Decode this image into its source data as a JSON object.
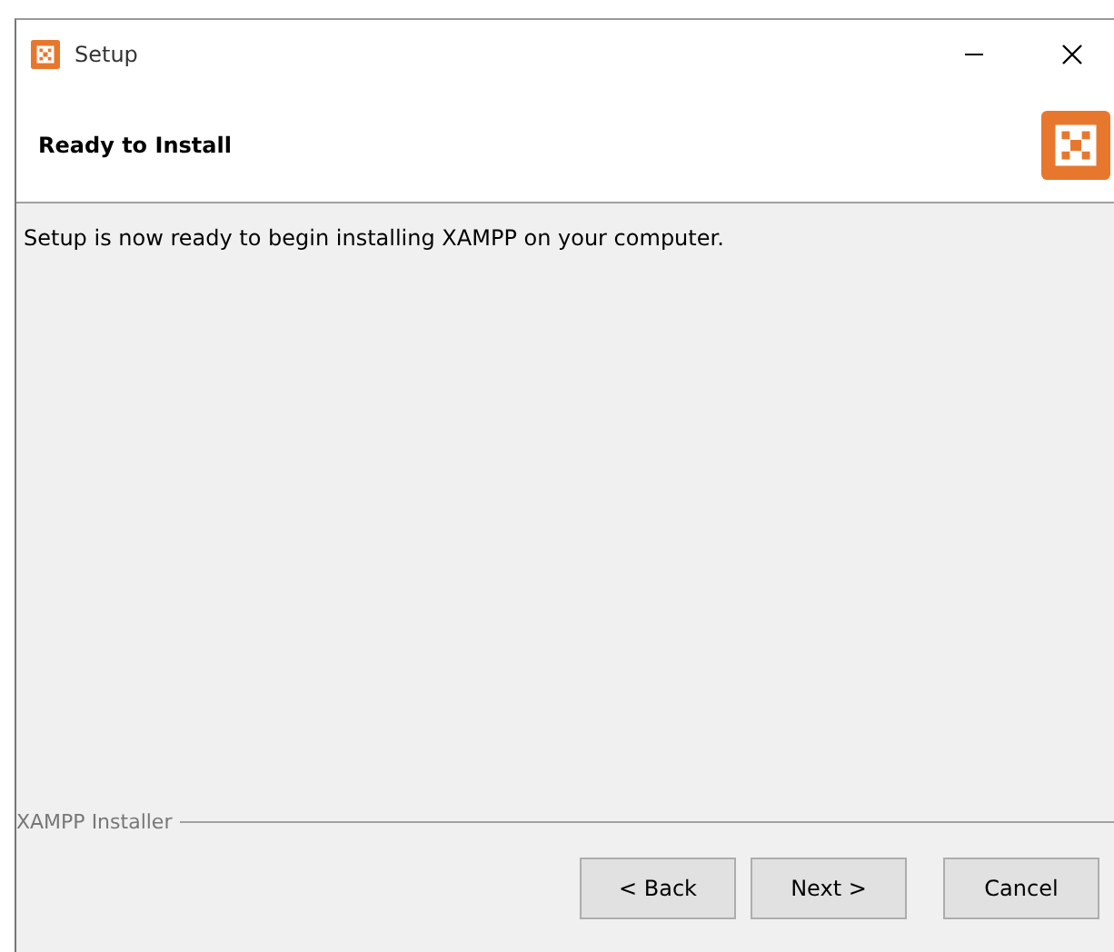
{
  "window": {
    "title": "Setup"
  },
  "header": {
    "title": "Ready to Install"
  },
  "body": {
    "message": "Setup is now ready to begin installing XAMPP on your computer."
  },
  "footer": {
    "brand": "XAMPP Installer"
  },
  "buttons": [
    {
      "label": "< Back",
      "kind": "back"
    },
    {
      "label": "Next >",
      "kind": "next"
    },
    {
      "label": "Cancel",
      "kind": "cancel"
    }
  ]
}
